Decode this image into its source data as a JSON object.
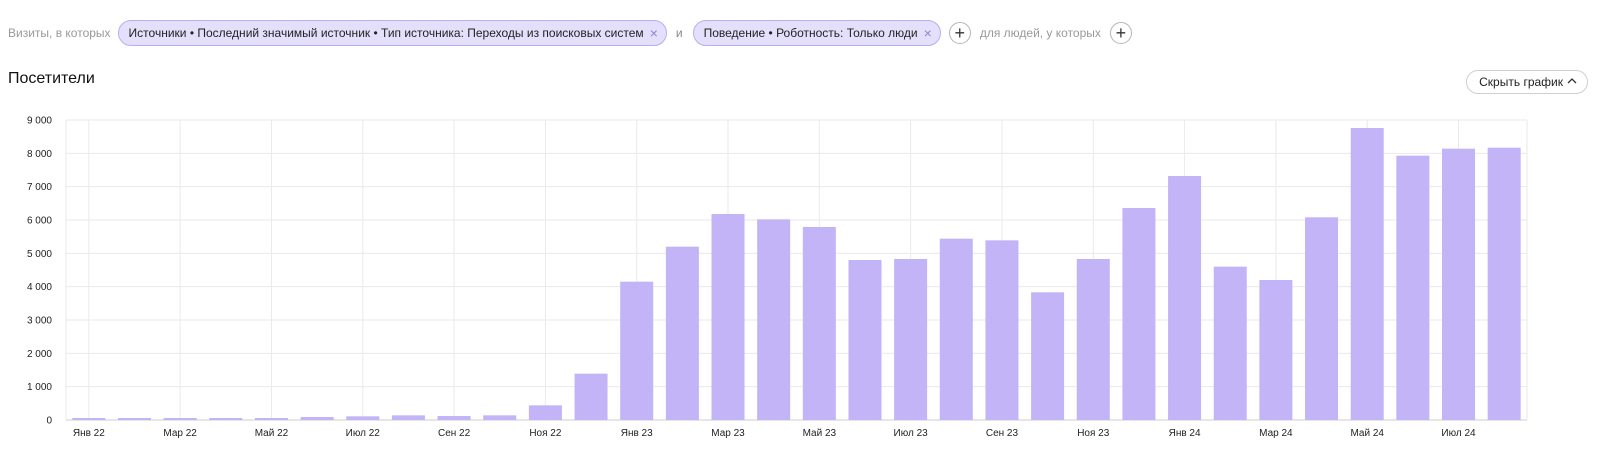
{
  "filters": {
    "prefix": "Визиты, в которых",
    "chips": [
      {
        "label": "Источники • Последний значимый источник • Тип источника: Переходы из поисковых систем"
      },
      {
        "label": "Поведение • Роботность: Только люди"
      }
    ],
    "conjunction": "и",
    "people_label": "для людей, у которых",
    "close_icon": "×",
    "plus_icon": "+"
  },
  "report": {
    "title": "Посетители",
    "hide_chart_label": "Скрыть график",
    "hide_chart_icon": "chevron-up-icon"
  },
  "chart_data": {
    "type": "bar",
    "title": "Посетители",
    "xlabel": "",
    "ylabel": "",
    "ylim": [
      0,
      9000
    ],
    "yticks": [
      0,
      1000,
      2000,
      3000,
      4000,
      5000,
      6000,
      7000,
      8000,
      9000
    ],
    "ytick_labels": [
      "0",
      "1 000",
      "2 000",
      "3 000",
      "4 000",
      "5 000",
      "6 000",
      "7 000",
      "8 000",
      "9 000"
    ],
    "categories": [
      "Янв 22",
      "Фев 22",
      "Мар 22",
      "Апр 22",
      "Май 22",
      "Июн 22",
      "Июл 22",
      "Авг 22",
      "Сен 22",
      "Окт 22",
      "Ноя 22",
      "Дек 22",
      "Янв 23",
      "Фев 23",
      "Мар 23",
      "Апр 23",
      "Май 23",
      "Июн 23",
      "Июл 23",
      "Авг 23",
      "Сен 23",
      "Окт 23",
      "Ноя 23",
      "Дек 23",
      "Янв 24",
      "Фев 24",
      "Мар 24",
      "Апр 24",
      "Май 24",
      "Июн 24",
      "Июл 24",
      "Авг 24"
    ],
    "xtick_labels": [
      "Янв 22",
      "",
      "Мар 22",
      "",
      "Май 22",
      "",
      "Июл 22",
      "",
      "Сен 22",
      "",
      "Ноя 22",
      "",
      "Янв 23",
      "",
      "Мар 23",
      "",
      "Май 23",
      "",
      "Июл 23",
      "",
      "Сен 23",
      "",
      "Ноя 23",
      "",
      "Янв 24",
      "",
      "Мар 24",
      "",
      "Май 24",
      "",
      "Июл 24",
      ""
    ],
    "values": [
      60,
      60,
      60,
      60,
      60,
      90,
      110,
      140,
      120,
      140,
      440,
      1390,
      4150,
      5200,
      6180,
      6020,
      5790,
      4800,
      4830,
      5440,
      5390,
      3830,
      4830,
      6360,
      7320,
      4600,
      4200,
      6080,
      8760,
      7930,
      8140,
      8170
    ],
    "grid": true,
    "bar_color": "#c3b3f7",
    "legend": "none"
  }
}
